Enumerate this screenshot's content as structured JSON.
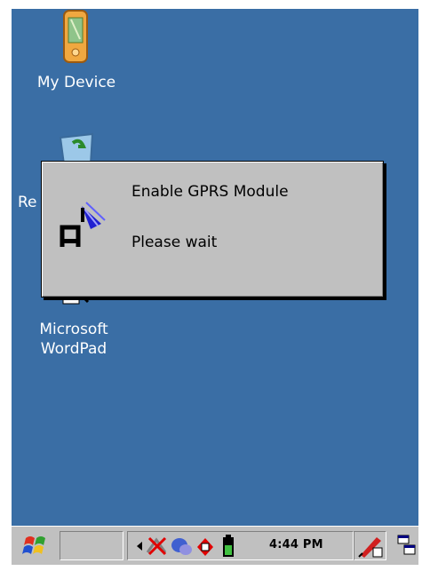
{
  "desktop": {
    "icons": [
      {
        "label": "My Device",
        "icon": "pda-device-icon"
      },
      {
        "label": "Re",
        "icon": "recycle-bin-icon"
      },
      {
        "label_line1": "Microsoft",
        "label_line2": "WordPad",
        "icon": "wordpad-icon"
      }
    ]
  },
  "dialog": {
    "title_line": "Enable GPRS Module",
    "message": "Please wait",
    "icon": "antenna-signal-icon"
  },
  "taskbar": {
    "start_icon": "windows-flag-icon",
    "clock": "4:44 PM",
    "tray_icons": [
      "back-arrow-icon",
      "network-disconnected-icon",
      "connection-icon",
      "network-adapter-icon",
      "battery-icon"
    ],
    "input_icon": "input-panel-pen-icon",
    "desktop_switch_icon": "show-desktop-icon"
  },
  "colors": {
    "desktop": "#3a6ea5",
    "chrome": "#c0c0c0",
    "title_accent": "#0000ff"
  }
}
